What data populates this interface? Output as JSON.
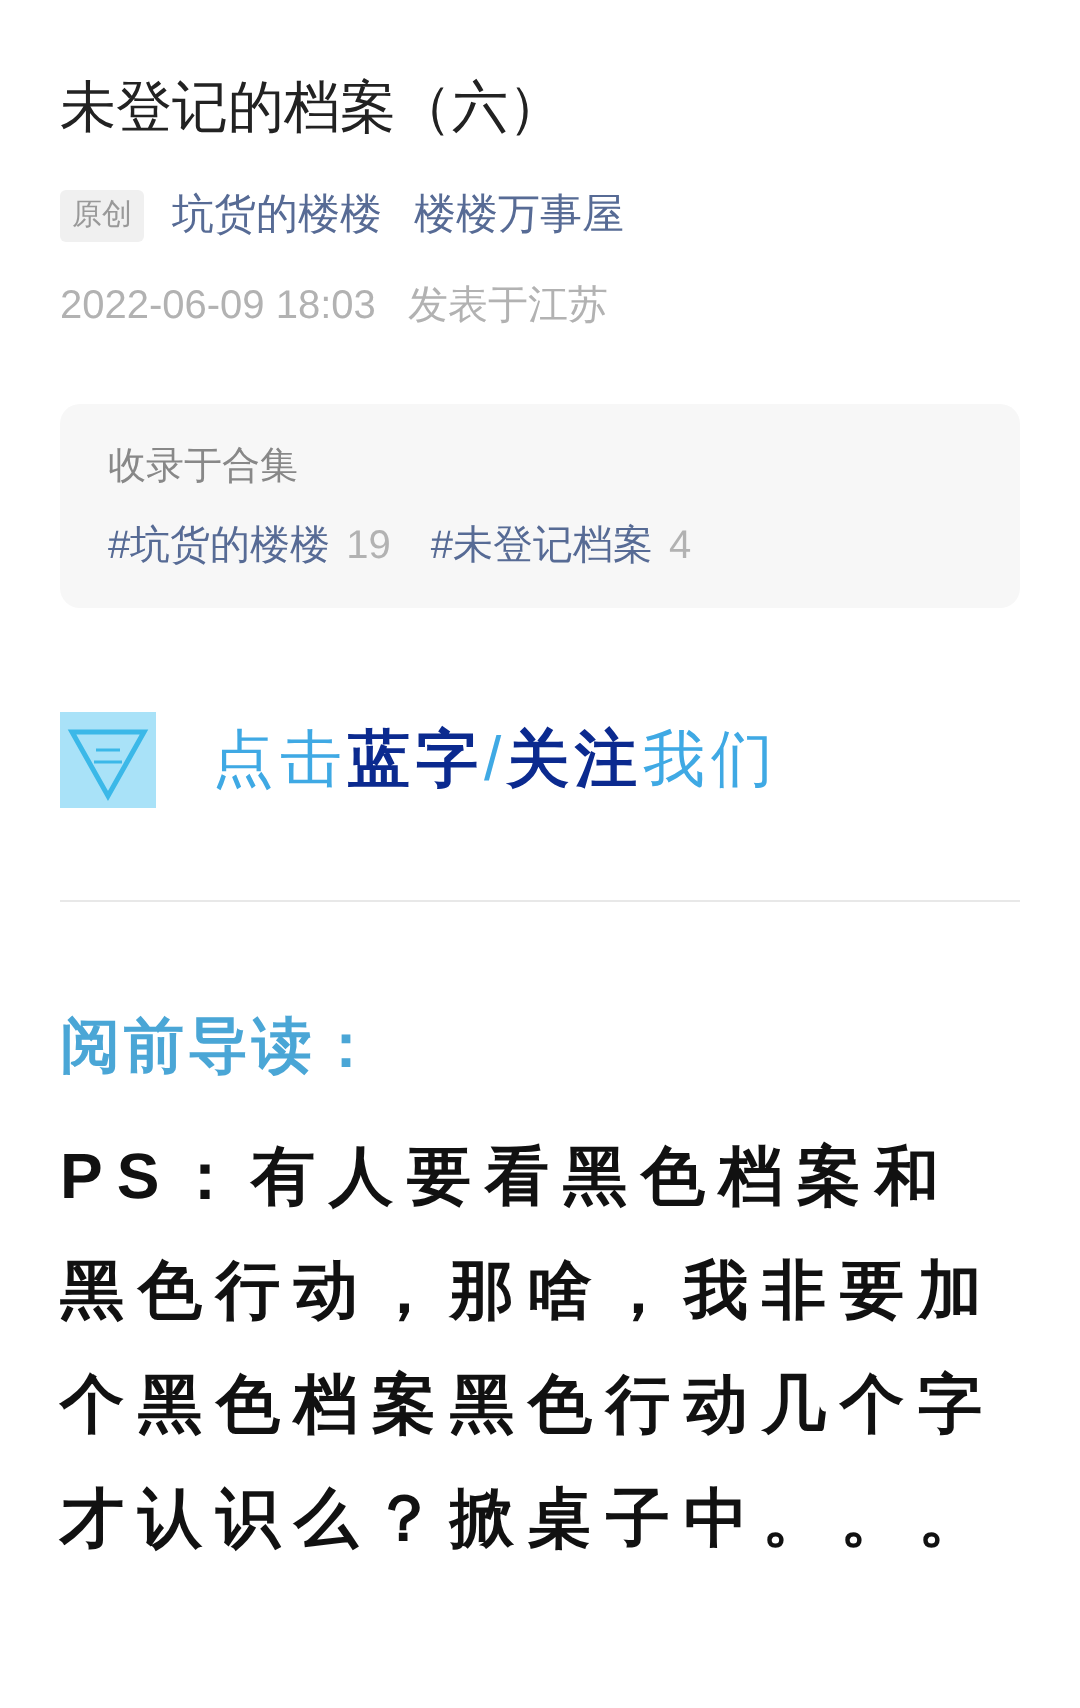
{
  "title": "未登记的档案（六）",
  "meta": {
    "badge": "原创",
    "author": "坑货的楼楼",
    "account": "楼楼万事屋"
  },
  "published": {
    "time": "2022-06-09 18:03",
    "location": "发表于江苏"
  },
  "collection": {
    "label": "收录于合集",
    "tags": [
      {
        "name": "#坑货的楼楼",
        "count": "19"
      },
      {
        "name": "#未登记档案",
        "count": "4"
      }
    ]
  },
  "follow_banner": {
    "segments": [
      {
        "text": "点击",
        "kind": "plain"
      },
      {
        "text": "蓝字",
        "kind": "strong"
      },
      {
        "text": "/",
        "kind": "plain"
      },
      {
        "text": "关注",
        "kind": "strong"
      },
      {
        "text": "我们",
        "kind": "plain"
      }
    ]
  },
  "intro_heading": "阅前导读：",
  "intro_body": "PS：有人要看黑色档案和黑色行动，那啥，我非要加个黑色档案黑色行动几个字才认识么？掀桌子中。。。"
}
